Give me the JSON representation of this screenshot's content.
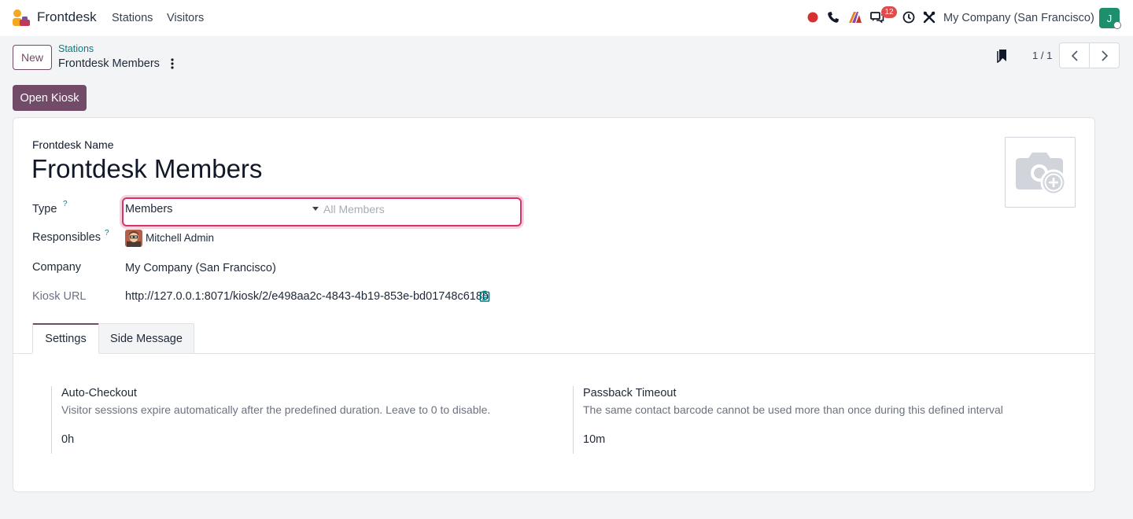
{
  "navbar": {
    "app_name": "Frontdesk",
    "menus": [
      "Stations",
      "Visitors"
    ],
    "messages_badge": "12",
    "company": "My Company (San Francisco)",
    "user_initial": "J",
    "icons": [
      "recording-dot-icon",
      "phone-icon",
      "ai-icon",
      "messages-icon",
      "clock-icon",
      "tools-icon"
    ]
  },
  "control": {
    "new_label": "New",
    "breadcrumb_parent": "Stations",
    "breadcrumb_current": "Frontdesk Members",
    "pager": "1 / 1",
    "open_kiosk_label": "Open Kiosk"
  },
  "form": {
    "name_label": "Frontdesk Name",
    "title": "Frontdesk Members",
    "type_label": "Type",
    "help_mark": "?",
    "type_value": "Members",
    "type_placeholder": "All Members",
    "responsibles_label": "Responsibles",
    "responsible_name": "Mitchell Admin",
    "company_label": "Company",
    "company_value": "My Company (San Francisco)",
    "kiosk_url_label": "Kiosk URL",
    "kiosk_url_value": "http://127.0.0.1:8071/kiosk/2/e498aa2c-4843-4b19-853e-bd01748c618b"
  },
  "tabs": [
    "Settings",
    "Side Message"
  ],
  "settings": {
    "auto_checkout": {
      "title": "Auto-Checkout",
      "description": "Visitor sessions expire automatically after the predefined duration. Leave to 0 to disable.",
      "value": "0h"
    },
    "passback": {
      "title": "Passback Timeout",
      "description": "The same contact barcode cannot be used more than once during this defined interval",
      "value": "10m"
    }
  },
  "colors": {
    "brand": "#714b67",
    "link": "#017e84",
    "focus": "#d6336c",
    "badge": "#e04b4b",
    "user_avatar": "#1d8f6d"
  }
}
